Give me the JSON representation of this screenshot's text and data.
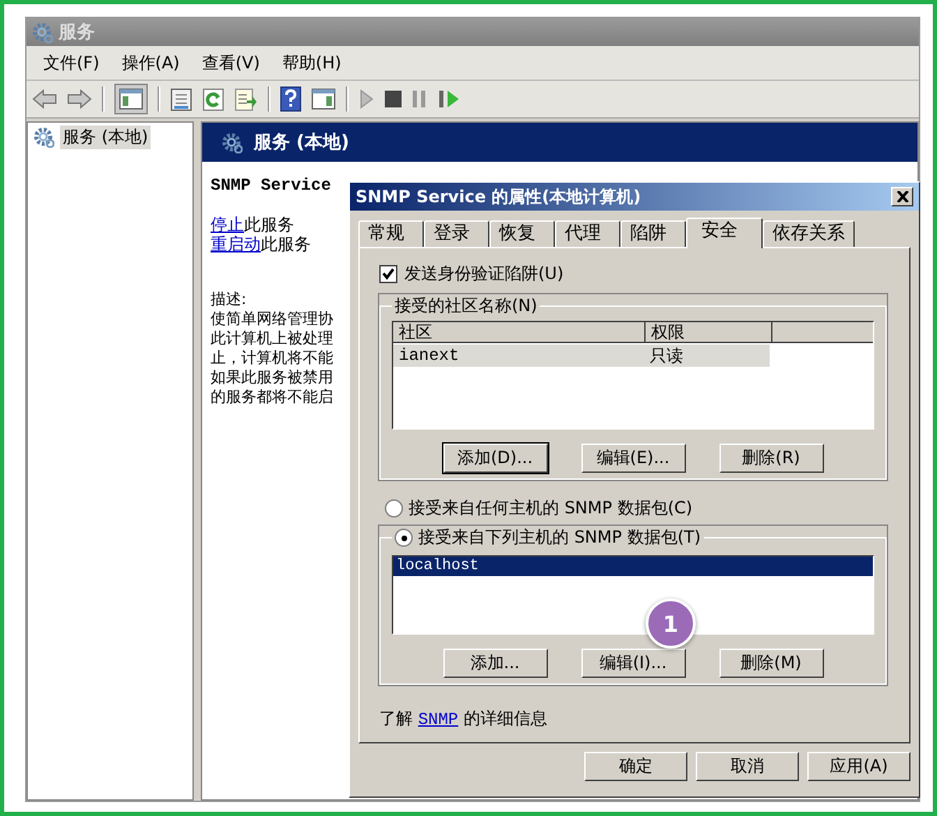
{
  "window": {
    "title": "服务"
  },
  "menu": [
    "文件(F)",
    "操作(A)",
    "查看(V)",
    "帮助(H)"
  ],
  "tree": [
    {
      "label": "服务 (本地)",
      "selected": true
    }
  ],
  "pane": {
    "title": "服务 (本地)",
    "service_name": "SNMP Service",
    "actions": [
      {
        "link": "停止",
        "text": "此服务"
      },
      {
        "link": "重启动",
        "text": "此服务"
      }
    ],
    "description_label": "描述:",
    "description_lines": [
      "使简单网络管理协",
      "此计算机上被处理",
      "止，计算机将不能",
      "如果此服务被禁用",
      "的服务都将不能启"
    ]
  },
  "dialog": {
    "title": "SNMP Service 的属性(本地计算机)",
    "tabs": [
      {
        "label": "常规",
        "selected": false
      },
      {
        "label": "登录",
        "selected": false
      },
      {
        "label": "恢复",
        "selected": false
      },
      {
        "label": "代理",
        "selected": false
      },
      {
        "label": "陷阱",
        "selected": false
      },
      {
        "label": "安全",
        "selected": true
      },
      {
        "label": "依存关系",
        "selected": false
      }
    ],
    "send_auth_trap": {
      "label": "发送身份验证陷阱(U)",
      "checked": true
    },
    "community": {
      "legend": "接受的社区名称(N)",
      "columns": [
        "社区",
        "权限"
      ],
      "rows": [
        {
          "cells": [
            "ianext",
            "只读"
          ],
          "selected": true
        }
      ],
      "buttons": [
        "添加(D)...",
        "编辑(E)...",
        "删除(R)"
      ]
    },
    "hosts": {
      "options": [
        {
          "label": "接受来自任何主机的 SNMP 数据包(C)",
          "selected": false
        },
        {
          "label": "接受来自下列主机的 SNMP 数据包(T)",
          "selected": true
        }
      ],
      "items": [
        {
          "label": "localhost",
          "selected": true
        }
      ],
      "buttons": [
        "添加...",
        "编辑(I)...",
        "删除(M)"
      ]
    },
    "info": {
      "before": "了解",
      "link": "SNMP",
      "after": "的详细信息"
    },
    "buttons": [
      "确定",
      "取消",
      "应用(A)"
    ]
  },
  "callout": {
    "label": "1"
  }
}
